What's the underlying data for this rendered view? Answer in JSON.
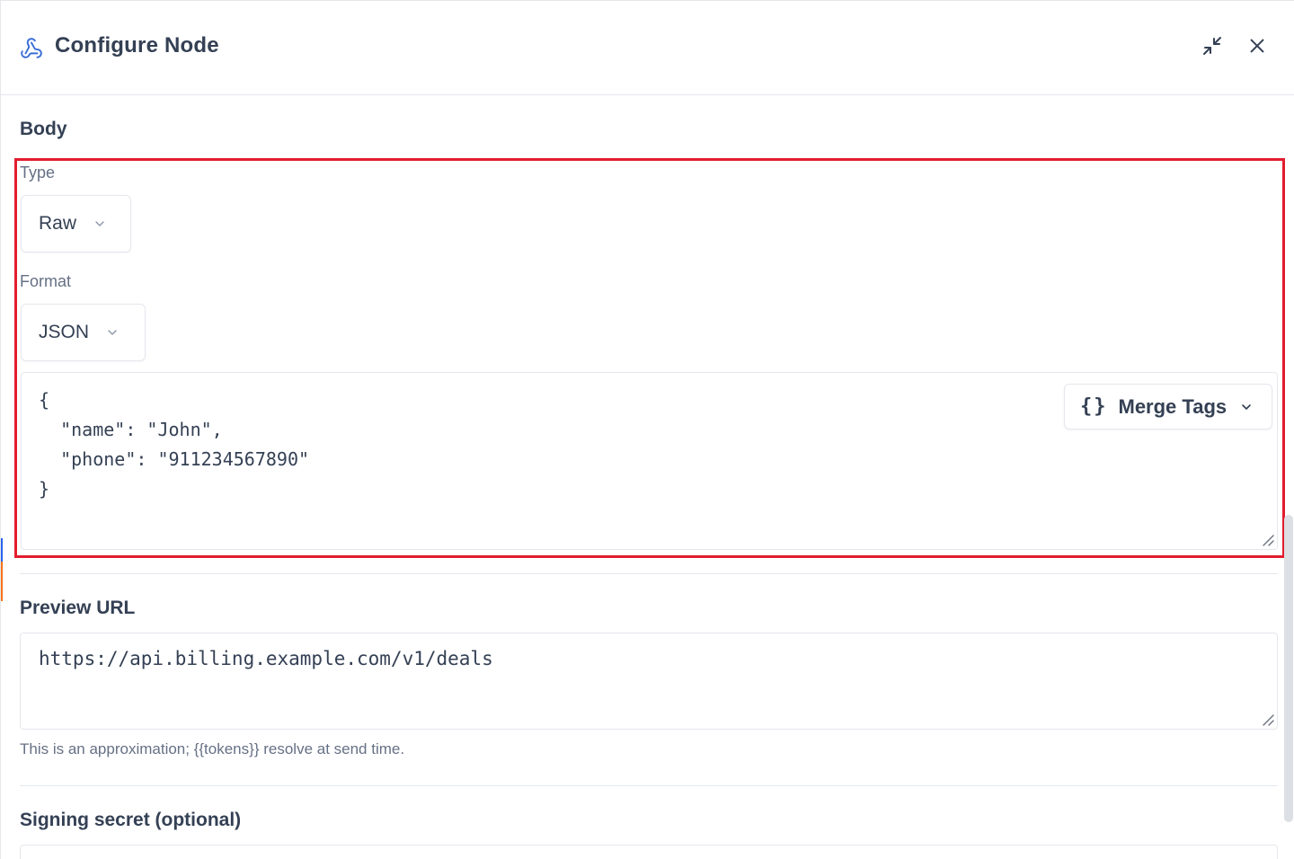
{
  "header": {
    "title": "Configure Node",
    "icon": "webhook-icon",
    "minimize_icon": "minimize-icon",
    "close_icon": "close-icon"
  },
  "body_section": {
    "title": "Body",
    "type": {
      "label": "Type",
      "value": "Raw"
    },
    "format": {
      "label": "Format",
      "value": "JSON"
    },
    "editor": {
      "content": "{\n  \"name\": \"John\",\n  \"phone\": \"911234567890\"\n}",
      "merge_tags_label": "Merge Tags",
      "merge_tags_icon": "{}"
    }
  },
  "preview_section": {
    "title": "Preview URL",
    "url": "https://api.billing.example.com/v1/deals",
    "hint": "This is an approximation; {{tokens}} resolve at send time."
  },
  "secret_section": {
    "title": "Signing secret (optional)",
    "value": ""
  },
  "colors": {
    "highlight": "#e11d2e",
    "accent_blue": "#2563eb",
    "text_primary": "#344054",
    "text_muted": "#667085"
  }
}
